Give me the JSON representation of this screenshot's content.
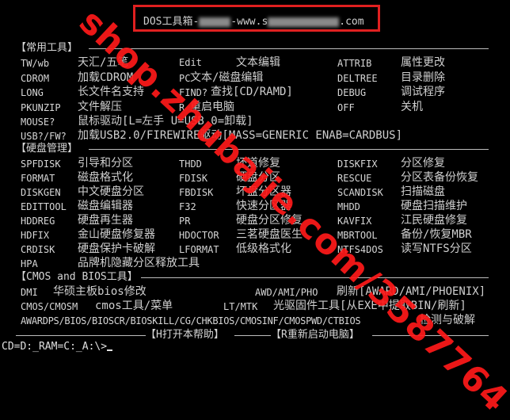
{
  "header": {
    "title_prefix": "DOS工具箱-",
    "title_mid": "-www.s",
    "title_suffix": ".com"
  },
  "sections": {
    "common": "【常用工具】",
    "disk": "【硬盘管理】",
    "cmos": "【CMOS and BIOS工具】"
  },
  "common_rows": [
    [
      {
        "c": "TW/wb",
        "d": "天汇/五笔"
      },
      {
        "c": "",
        "d": "Edit",
        "small": true
      },
      {
        "c": "",
        "d": "文本编辑"
      },
      {
        "c": "ATTRIB",
        "d": "属性更改"
      }
    ],
    [
      {
        "c": "CDROM",
        "d": "加载CDROM"
      },
      {
        "c": "PC",
        "d": "文本/磁盘编辑"
      },
      {
        "c": "",
        "d": ""
      },
      {
        "c": "DELTREE",
        "d": "目录删除"
      }
    ],
    [
      {
        "c": "LONG",
        "d": "长文件名支持"
      },
      {
        "c": "FIND?",
        "d": "查找[CD/RAMD]"
      },
      {
        "c": "",
        "d": ""
      },
      {
        "c": "DEBUG",
        "d": "调试程序"
      }
    ],
    [
      {
        "c": "PKUNZIP",
        "d": "文件解压"
      },
      {
        "c": "R",
        "d": "重启电脑"
      },
      {
        "c": "",
        "d": ""
      },
      {
        "c": "OFF",
        "d": "关机"
      }
    ]
  ],
  "common_extra": {
    "mouse_cmd": "MOUSE?",
    "mouse_desc": "鼠标驱动[L=左手 U=USB 0=卸载]",
    "usb_cmd": "USB?/FW?",
    "usb_desc": "加载USB2.0/FIREWIRE驱动[MASS=GENERIC ENAB=CARDBUS]"
  },
  "disk_rows": [
    [
      {
        "c": "SPFDISK",
        "d": "引导和分区"
      },
      {
        "c": "THDD",
        "d": "坏道修复"
      },
      {
        "c": "DISKFIX",
        "d": "分区修复"
      }
    ],
    [
      {
        "c": "FORMAT",
        "d": "磁盘格式化"
      },
      {
        "c": "FDISK",
        "d": "硬盘分区"
      },
      {
        "c": "RESCUE",
        "d": "分区表备份恢复"
      }
    ],
    [
      {
        "c": "DISKGEN",
        "d": "中文硬盘分区"
      },
      {
        "c": "FBDISK",
        "d": "坏盘分区器"
      },
      {
        "c": "SCANDISK",
        "d": "扫描磁盘"
      }
    ],
    [
      {
        "c": "EDITTOOL",
        "d": "磁盘编辑器"
      },
      {
        "c": "F32",
        "d": "快速分区器"
      },
      {
        "c": "MHDD",
        "d": "硬盘扫描维护"
      }
    ],
    [
      {
        "c": "HDDREG",
        "d": "硬盘再生器"
      },
      {
        "c": "PR",
        "d": "硬盘分区修复"
      },
      {
        "c": "KAVFIX",
        "d": "江民硬盘修复"
      }
    ],
    [
      {
        "c": "HDFIX",
        "d": "金山硬盘修复器"
      },
      {
        "c": "HDOCTOR",
        "d": "三茗硬盘医生"
      },
      {
        "c": "MBRTOOL",
        "d": "备份/恢复MBR"
      }
    ],
    [
      {
        "c": "CRDISK",
        "d": "硬盘保护卡破解"
      },
      {
        "c": "LFORMAT",
        "d": "低级格式化"
      },
      {
        "c": "NTFS4DOS",
        "d": "读写NTFS分区"
      }
    ],
    [
      {
        "c": "HPA",
        "d": "品牌机隐藏分区释放工具"
      }
    ]
  ],
  "cmos_rows": {
    "dmi_cmd": "DMI",
    "dmi_desc": "华硕主板bios修改",
    "awd_cmd": "AWD/AMI/PHO",
    "awd_desc": "刷新[AWARD/AMI/PHOENIX]",
    "cmos_cmd": "CMOS/CMOSM",
    "cmos_desc": "cmos工具/菜单",
    "lt_cmd": "LT/MTK",
    "lt_desc": "光驱固件工具[从EXE中提取BIN/刷新]",
    "award_cmd": "AWARDPS/BIOS/BIOSCR/BIOSKILL/CG/CHKBIOS/CMOSINF/CMOSPWD/CTBIOS",
    "award_desc": "检测与破解"
  },
  "footer": {
    "help": "【H打开本帮助】",
    "reboot": "【R重新启动电脑】"
  },
  "prompt": "CD=D:_RAM=C:_A:\\>",
  "watermark": "shop.zhubajie.com/3587764",
  "colors": {
    "bg": "#000000",
    "text": "#c8c8c8",
    "watermark": "#ff1a1a",
    "box": "#e02020"
  }
}
